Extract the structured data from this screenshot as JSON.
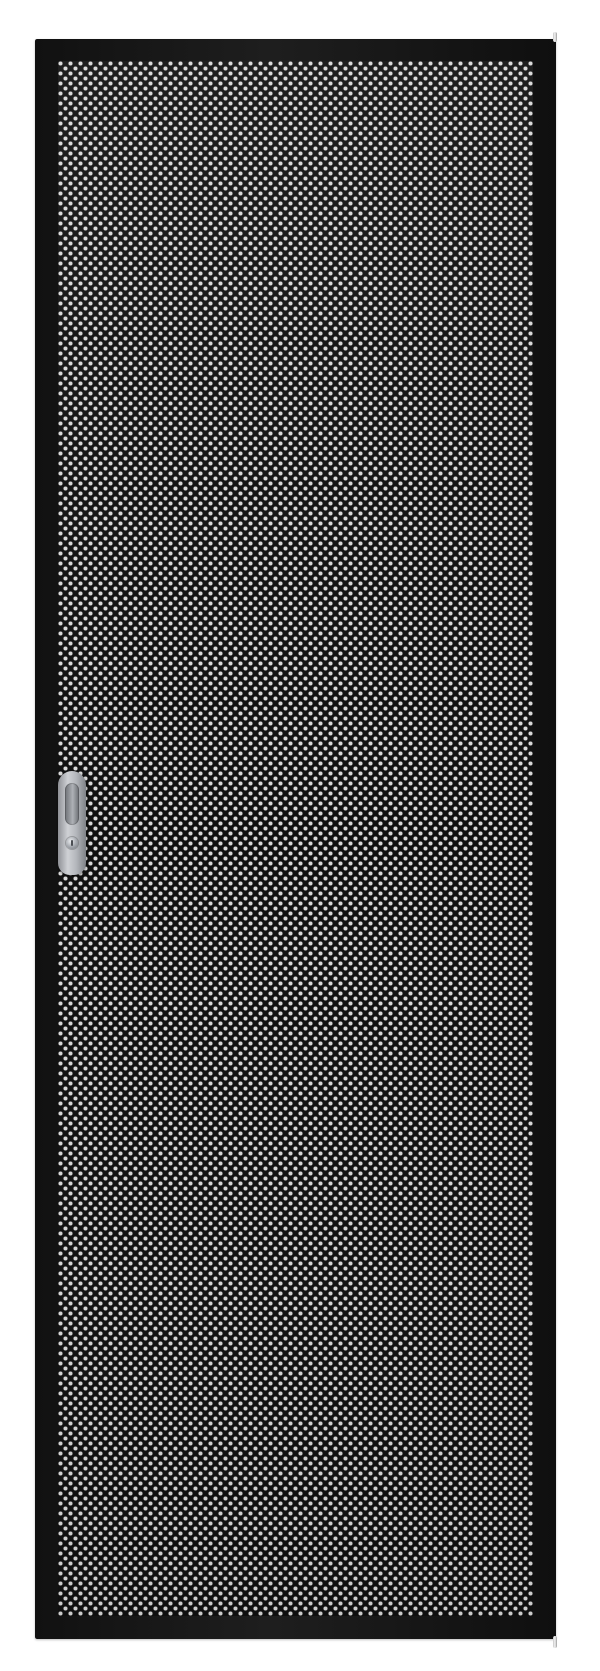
{
  "image": {
    "subject": "perforated-door",
    "colors": {
      "background": "#ffffff",
      "frame": "#1e1e1e",
      "mesh_base": "#111111",
      "mesh_highlight": "#d9d9d9",
      "handle": "#b5b8bc"
    }
  }
}
